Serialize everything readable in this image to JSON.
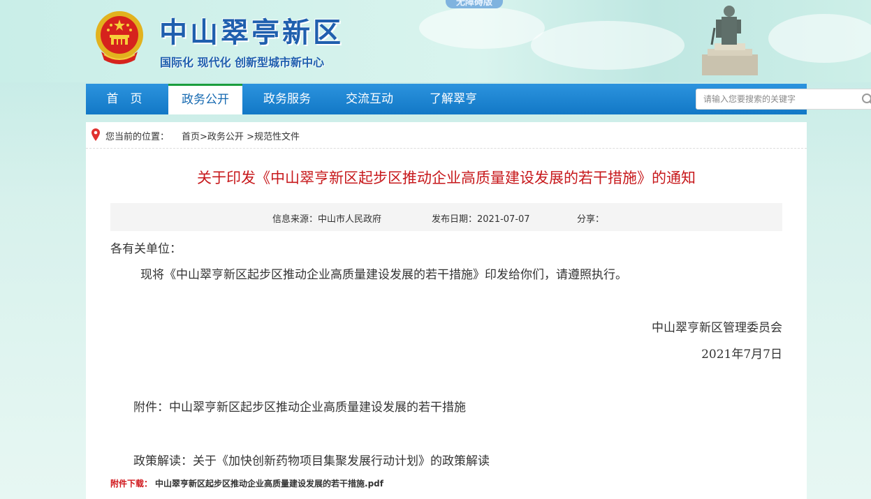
{
  "header": {
    "site_title": "中山翠亭新区",
    "slogan": "国际化  现代化  创新型城市新中心",
    "accessibility_label": "无障碍版"
  },
  "nav": {
    "items": [
      {
        "label": "首　页",
        "active": false
      },
      {
        "label": "政务公开",
        "active": true
      },
      {
        "label": "政务服务",
        "active": false
      },
      {
        "label": "交流互动",
        "active": false
      },
      {
        "label": "了解翠亨",
        "active": false
      }
    ],
    "search_placeholder": "请输入您要搜索的关键字"
  },
  "breadcrumb": {
    "label": "您当前的位置：",
    "items": [
      "首页",
      "政务公开",
      "规范性文件"
    ],
    "separator": ">"
  },
  "article": {
    "title": "关于印发《中山翠亨新区起步区推动企业高质量建设发展的若干措施》的通知",
    "source": "信息来源：中山市人民政府",
    "date": "发布日期：2021-07-07",
    "share": "分享：",
    "salutation": "各有关单位：",
    "body": "现将《中山翠亨新区起步区推动企业高质量建设发展的若干措施》印发给你们，请遵照执行。",
    "signature": "中山翠亨新区管理委员会",
    "sign_date": "2021年7月7日",
    "attachment": "附件：中山翠亨新区起步区推动企业高质量建设发展的若干措施",
    "interpretation": "政策解读：关于《加快创新药物项目集聚发展行动计划》的政策解读",
    "download_label": "附件下载：",
    "download_file": "中山翠亨新区起步区推动企业高质量建设发展的若干措施.pdf"
  },
  "colors": {
    "nav_blue": "#1a84d2",
    "title_red": "#c7191c",
    "brand_blue": "#1f5fae",
    "active_underline": "#1a9d3d"
  },
  "icons": [
    "national-emblem-icon",
    "search-icon",
    "location-pin-icon",
    "statue-image"
  ]
}
